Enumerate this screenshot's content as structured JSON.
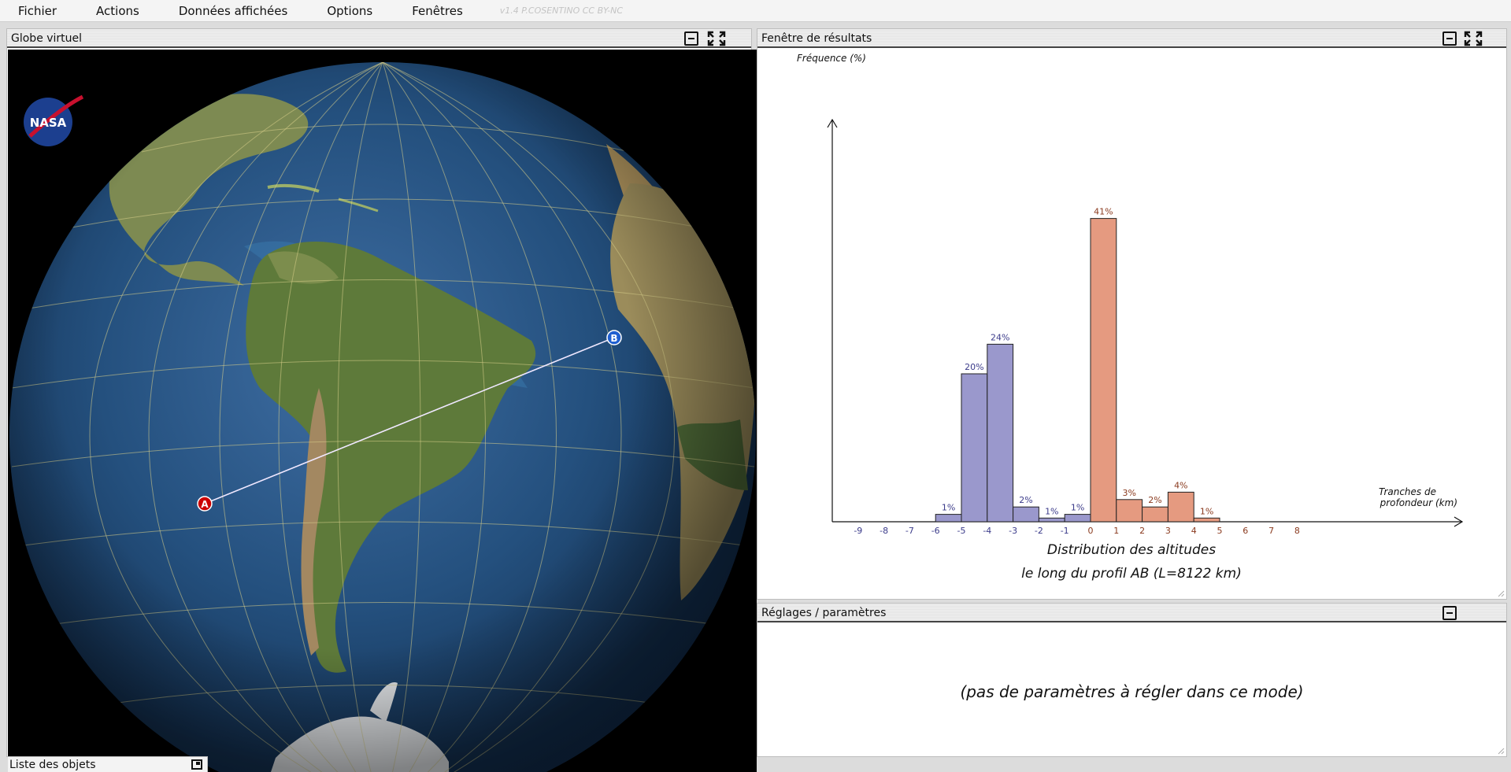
{
  "menu": {
    "items": [
      "Fichier",
      "Actions",
      "Données affichées",
      "Options",
      "Fenêtres"
    ],
    "version": "v1.4 P.COSENTINO CC BY-NC"
  },
  "globe_panel": {
    "title": "Globe virtuel",
    "logo_text": "NASA",
    "point_a": "A",
    "point_b": "B",
    "object_list": "Liste des objets"
  },
  "results_panel": {
    "title": "Fenêtre de résultats"
  },
  "settings_panel": {
    "title": "Réglages / paramètres",
    "message": "(pas de paramètres à régler dans ce mode)"
  },
  "colors": {
    "ocean_bar": "#9a98cc",
    "land_bar": "#e59a80",
    "ocean_label": "#3b3b8a",
    "land_label": "#8a3a1e"
  },
  "chart_data": {
    "type": "bar",
    "title": "Distribution des altitudes",
    "subtitle": "le long du profil AB (L=8122 km)",
    "ylabel": "Fréquence (%)",
    "xlabel": "Tranches de profondeur (km)",
    "x_ticks": [
      -9,
      -8,
      -7,
      -6,
      -5,
      -4,
      -3,
      -2,
      -1,
      0,
      1,
      2,
      3,
      4,
      5,
      6,
      7,
      8
    ],
    "xlim": [
      -10,
      10
    ],
    "ylim": [
      0,
      45
    ],
    "grid": false,
    "bins": [
      {
        "from": -6,
        "to": -5,
        "value": 1,
        "label": "1%",
        "kind": "ocean"
      },
      {
        "from": -5,
        "to": -4,
        "value": 20,
        "label": "20%",
        "kind": "ocean"
      },
      {
        "from": -4,
        "to": -3,
        "value": 24,
        "label": "24%",
        "kind": "ocean"
      },
      {
        "from": -3,
        "to": -2,
        "value": 2,
        "label": "2%",
        "kind": "ocean"
      },
      {
        "from": -2,
        "to": -1,
        "value": 0.5,
        "label": "1%",
        "kind": "ocean"
      },
      {
        "from": -1,
        "to": 0,
        "value": 1,
        "label": "1%",
        "kind": "ocean"
      },
      {
        "from": 0,
        "to": 1,
        "value": 41,
        "label": "41%",
        "kind": "land"
      },
      {
        "from": 1,
        "to": 2,
        "value": 3,
        "label": "3%",
        "kind": "land"
      },
      {
        "from": 2,
        "to": 3,
        "value": 2,
        "label": "2%",
        "kind": "land"
      },
      {
        "from": 3,
        "to": 4,
        "value": 4,
        "label": "4%",
        "kind": "land"
      },
      {
        "from": 4,
        "to": 5,
        "value": 0.5,
        "label": "1%",
        "kind": "land"
      }
    ]
  }
}
